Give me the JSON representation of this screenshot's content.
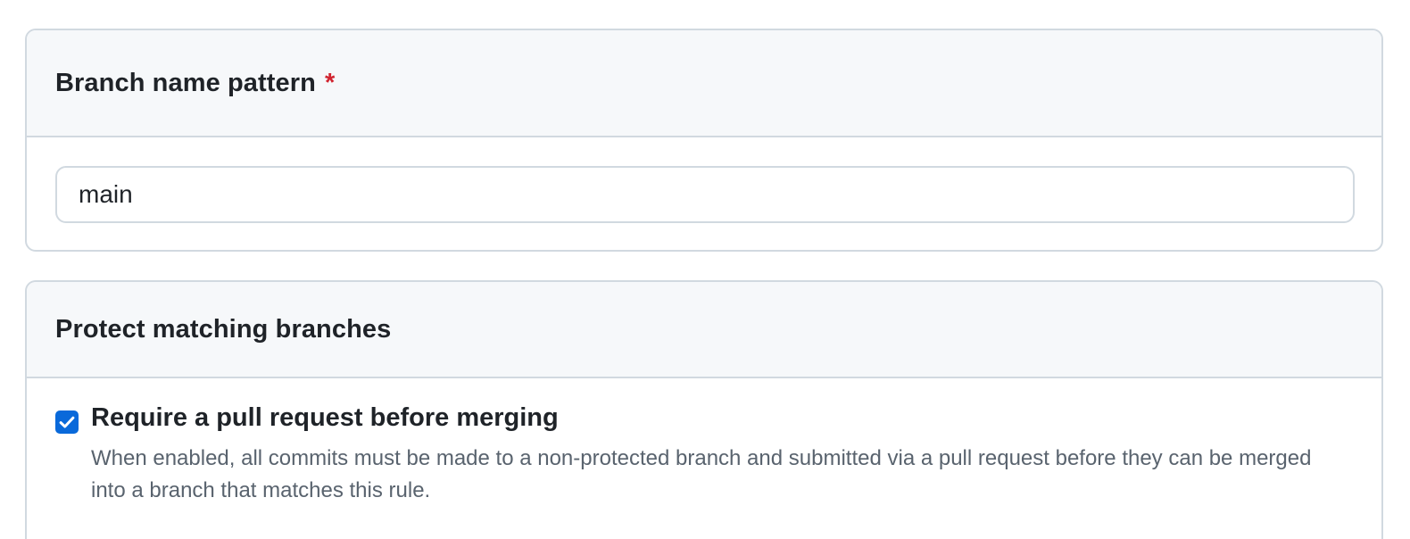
{
  "branch_pattern_section": {
    "title": "Branch name pattern",
    "required_marker": "*",
    "input_value": "main"
  },
  "protect_section": {
    "title": "Protect matching branches",
    "rules": [
      {
        "label": "Require a pull request before merging",
        "checked": true,
        "description": "When enabled, all commits must be made to a non-protected branch and submitted via a pull request before they can be merged into a branch that matches this rule."
      }
    ]
  },
  "colors": {
    "accent": "#0969da",
    "required": "#d1242f",
    "header_bg": "#f6f8fa",
    "border": "#d1d9e0",
    "muted_text": "#59636e"
  },
  "icons": {
    "checkbox_checked": "check-icon"
  }
}
